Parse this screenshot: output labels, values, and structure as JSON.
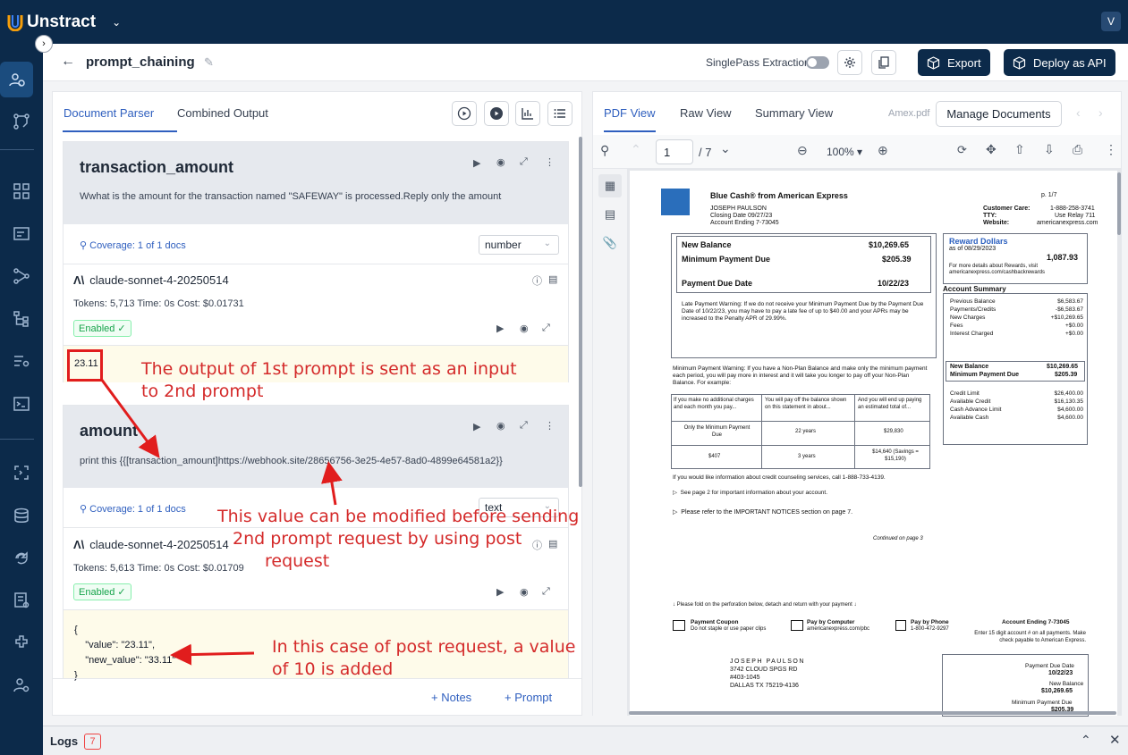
{
  "topbar": {
    "brand": "Unstract",
    "avatar": "V"
  },
  "header": {
    "title": "prompt_chaining",
    "singlepass_label": "SinglePass Extraction",
    "export_label": "Export",
    "deploy_label": "Deploy as API"
  },
  "left_tabs": {
    "parser": "Document Parser",
    "combined": "Combined Output"
  },
  "prompts": [
    {
      "name": "transaction_amount",
      "text": "Wwhat is the amount for the transaction named \"SAFEWAY\" is processed.Reply only the amount",
      "coverage": "Coverage: 1 of 1 docs",
      "type": "number",
      "model": "claude-sonnet-4-20250514",
      "stats": "Tokens: 5,713   Time: 0s   Cost: $0.01731",
      "enabled": "Enabled",
      "output": "23.11"
    },
    {
      "name": "amount",
      "text": "print this {{[transaction_amount]https://webhook.site/28656756-3e25-4e57-8ad0-4899e64581a2}}",
      "coverage": "Coverage: 1 of 1 docs",
      "type": "text",
      "model": "claude-sonnet-4-20250514",
      "stats": "Tokens: 5,613   Time: 0s   Cost: $0.01709",
      "enabled": "Enabled",
      "output": "{\n    \"value\": \"23.11\",\n    \"new_value\": \"33.11\"\n}"
    }
  ],
  "left_footer": {
    "notes": "Notes",
    "prompt": "Prompt"
  },
  "right_tabs": {
    "pdf": "PDF View",
    "raw": "Raw View",
    "summary": "Summary View"
  },
  "doc": {
    "filename": "Amex.pdf",
    "manage": "Manage Documents",
    "page": "1",
    "total": "/ 7",
    "zoom": "100%"
  },
  "statement": {
    "brand": "Blue Cash® from American Express",
    "page_ref": "p. 1/7",
    "name": "JOSEPH PAULSON",
    "closing": "Closing Date 09/27/23",
    "account": "Account Ending 7-73045",
    "care_l": "Customer Care:",
    "care_v": "1-888-258-3741",
    "tty_l": "TTY:",
    "tty_v": "Use Relay 711",
    "web_l": "Website:",
    "web_v": "americanexpress.com",
    "nb_l": "New Balance",
    "nb_v": "$10,269.65",
    "mp_l": "Minimum Payment Due",
    "mp_v": "$205.39",
    "pd_l": "Payment Due Date",
    "pd_v": "10/22/23",
    "late": "Late Payment Warning: If we do not receive your Minimum Payment Due by the Payment Due Date of 10/22/23, you may have to pay a late fee of up to $40.00 and your APRs may be increased to the Penalty APR of 29.99%.",
    "rewards": "Reward Dollars",
    "rewards_asof": "as of 08/29/2023",
    "rewards_v": "1,087.93",
    "rewards_note": "For more details about Rewards, visit americanexpress.com/cashbackrewards",
    "acct_summary": "Account Summary",
    "summary": [
      [
        "Previous Balance",
        "$6,583.67"
      ],
      [
        "Payments/Credits",
        "-$6,583.67"
      ],
      [
        "New Charges",
        "+$10,269.65"
      ],
      [
        "Fees",
        "+$0.00"
      ],
      [
        "Interest Charged",
        "+$0.00"
      ]
    ],
    "s_nb_l": "New Balance",
    "s_nb_v": "$10,269.65",
    "s_mp_l": "Minimum Payment Due",
    "s_mp_v": "$205.39",
    "limits": [
      [
        "Credit Limit",
        "$26,400.00"
      ],
      [
        "Available Credit",
        "$16,130.35"
      ],
      [
        "Cash Advance Limit",
        "$4,600.00"
      ],
      [
        "Available Cash",
        "$4,600.00"
      ]
    ],
    "mpw": "Minimum Payment Warning: If you have a Non-Plan Balance and make only the minimum payment each period, you will pay more in interest and it will take you longer to pay off your Non-Plan Balance. For example:",
    "th1": "If you make no additional charges and each month you pay...",
    "th2": "You will pay off the balance shown on this statement in about...",
    "th3": "And you will end up paying an estimated total of...",
    "r1c1": "Only the Minimum Payment Due",
    "r1c2": "22 years",
    "r1c3": "$29,830",
    "r2c1": "$407",
    "r2c2": "3 years",
    "r2c3": "$14,640 (Savings = $15,190)",
    "counsel": "If you would like information about credit counseling services, call 1-888-733-4139.",
    "see2": "See page 2 for important information about your account.",
    "refer": "Please refer to the IMPORTANT NOTICES section on page 7.",
    "cont": "Continued on page 3",
    "fold": "Please fold on the perforation below, detach and return with your payment",
    "coupon": "Payment Coupon",
    "coupon_s": "Do not staple or use paper clips",
    "computer": "Pay by Computer",
    "computer_s": "americanexpress.com/pbc",
    "phone": "Pay by Phone",
    "phone_s": "1-800-472-9297",
    "acct_end": "Account Ending 7-73045",
    "enter": "Enter 15 digit account # on all payments. Make check payable to American Express.",
    "addr1": "JOSEPH PAULSON",
    "addr2": "3742 CLOUD SPGS RD",
    "addr3": "#403-1045",
    "addr4": "DALLAS TX 75219-4136",
    "c_pd_l": "Payment Due Date",
    "c_pd_v": "10/22/23",
    "c_nb_l": "New Balance",
    "c_nb_v": "$10,269.65",
    "c_mp_l": "Minimum Payment Due",
    "c_mp_v": "$205.39"
  },
  "logs": {
    "label": "Logs",
    "count": "7"
  },
  "annotations": {
    "a1_l1": "The output of 1st prompt is sent as an input",
    "a1_l2": "to 2nd prompt",
    "a2_l1": "This value can be modified before sending",
    "a2_l2": "2nd prompt request by using post",
    "a2_l3": "request",
    "a3_l1": "In this case of post request, a value",
    "a3_l2": "of 10 is added"
  },
  "colors": {
    "navy": "#0c2a4a",
    "accent": "#2f5fbf",
    "annotation": "#d42a2a"
  }
}
